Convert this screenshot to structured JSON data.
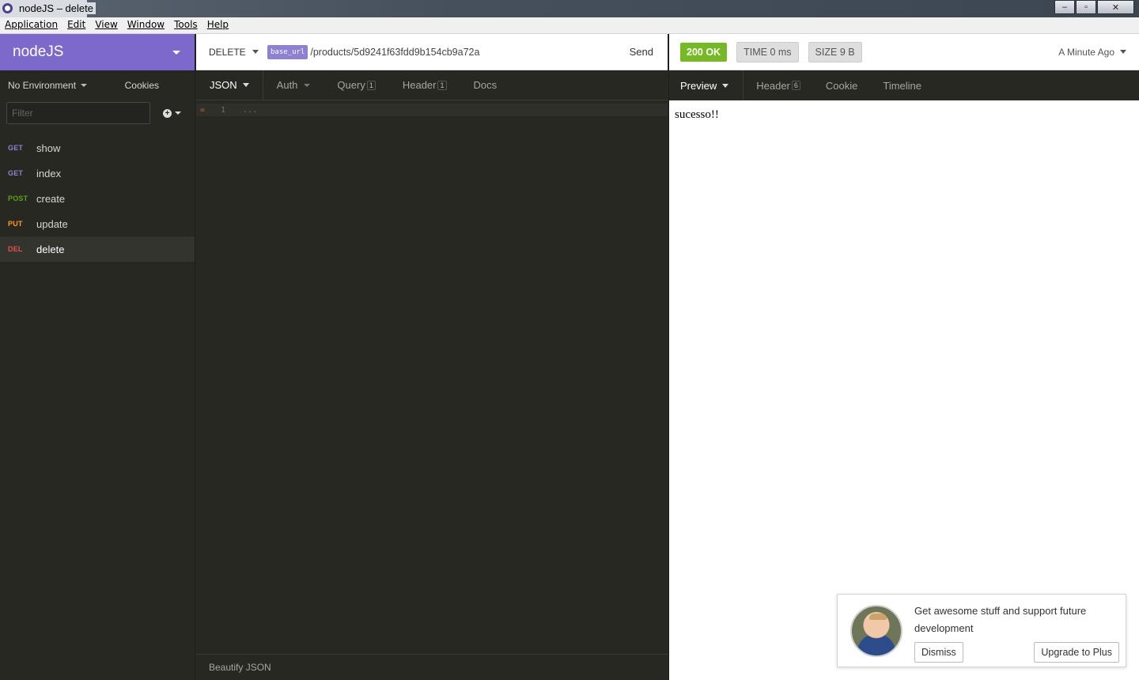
{
  "window": {
    "title": "nodeJS – delete",
    "controls": {
      "minimize": "–",
      "maximize": "▫",
      "close": "✕"
    }
  },
  "menu": [
    "Application",
    "Edit",
    "View",
    "Window",
    "Tools",
    "Help"
  ],
  "sidebar": {
    "workspace": "nodeJS",
    "environment": "No Environment",
    "cookies": "Cookies",
    "filter_placeholder": "Filter",
    "requests": [
      {
        "method": "GET",
        "name": "show"
      },
      {
        "method": "GET",
        "name": "index"
      },
      {
        "method": "POST",
        "name": "create"
      },
      {
        "method": "PUT",
        "name": "update"
      },
      {
        "method": "DEL",
        "name": "delete"
      }
    ]
  },
  "request": {
    "method": "DELETE",
    "base_tag": "base_url",
    "path": "/products/5d9241f63fdd9b154cb9a72a",
    "send": "Send",
    "tabs": {
      "body": "JSON",
      "auth": "Auth",
      "query": "Query",
      "query_count": "1",
      "header": "Header",
      "header_count": "1",
      "docs": "Docs"
    },
    "editor": {
      "line_number": "1",
      "placeholder": "..."
    },
    "footer": "Beautify JSON"
  },
  "response": {
    "status": "200 OK",
    "time_label": "TIME",
    "time_value": "0 ms",
    "size_label": "SIZE",
    "size_value": "9 B",
    "when": "A Minute Ago",
    "tabs": {
      "preview": "Preview",
      "header": "Header",
      "header_count": "6",
      "cookie": "Cookie",
      "timeline": "Timeline"
    },
    "body": "sucesso!!"
  },
  "toast": {
    "message": "Get awesome stuff and support future development",
    "dismiss": "Dismiss",
    "upgrade": "Upgrade to Plus"
  },
  "colors": {
    "workspace_bg": "#7d69cb",
    "dark_bg": "#272822",
    "status_ok": "#75ba24",
    "get": "#8f80d6",
    "post": "#59a210",
    "put": "#ff9a1f",
    "delete": "#e15251"
  }
}
